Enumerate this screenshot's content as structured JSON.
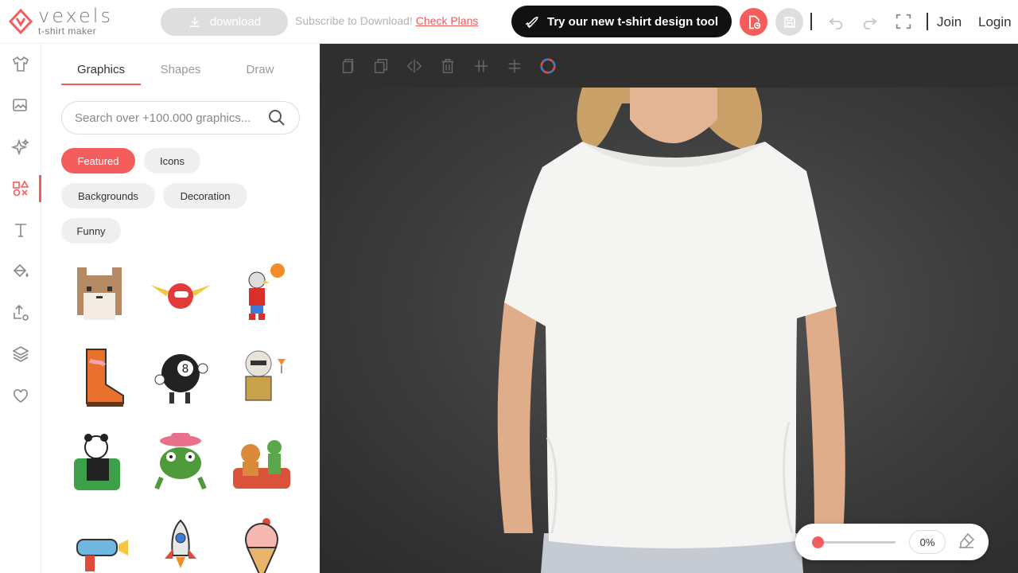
{
  "brand": {
    "name": "vexels",
    "subtitle": "t-shirt maker",
    "accent": "#f55d5d"
  },
  "header": {
    "download_label": "download",
    "subscribe_text": "Subscribe to Download!",
    "check_plans_label": "Check Plans",
    "tshirt_tool_label": "Try our new t-shirt design tool",
    "join_label": "Join",
    "login_label": "Login"
  },
  "rail": {
    "items": [
      {
        "icon": "tshirt-icon"
      },
      {
        "icon": "image-upload-icon"
      },
      {
        "icon": "sparkles-icon"
      },
      {
        "icon": "shapes-icon",
        "active": true
      },
      {
        "icon": "text-icon"
      },
      {
        "icon": "paint-bucket-icon"
      },
      {
        "icon": "upload-icon"
      },
      {
        "icon": "layers-icon"
      },
      {
        "icon": "heart-icon"
      }
    ]
  },
  "panel": {
    "tabs": [
      {
        "label": "Graphics",
        "active": true
      },
      {
        "label": "Shapes",
        "active": false
      },
      {
        "label": "Draw",
        "active": false
      }
    ],
    "search_placeholder": "Search over +100.000 graphics...",
    "chips": [
      {
        "label": "Featured",
        "active": true
      },
      {
        "label": "Icons",
        "active": false
      },
      {
        "label": "Backgrounds",
        "active": false
      },
      {
        "label": "Decoration",
        "active": false
      },
      {
        "label": "Funny",
        "active": false
      }
    ],
    "graphics": [
      "pixel-cat-graphic",
      "winged-helmet-graphic",
      "eagle-basketball-graphic",
      "cowboy-boot-graphic",
      "eight-ball-graphic",
      "dog-martini-graphic",
      "panda-armchair-graphic",
      "frog-cowboy-hat-graphic",
      "monkey-dino-couch-graphic",
      "ray-gun-graphic",
      "rocket-graphic",
      "ice-cream-graphic"
    ]
  },
  "toolbar": {
    "tools": [
      "copy-icon",
      "duplicate-icon",
      "flip-icon",
      "delete-icon",
      "align-horizontal-icon",
      "align-vertical-icon",
      "color-wheel-icon"
    ]
  },
  "zoom": {
    "value": 0,
    "label": "0%"
  }
}
